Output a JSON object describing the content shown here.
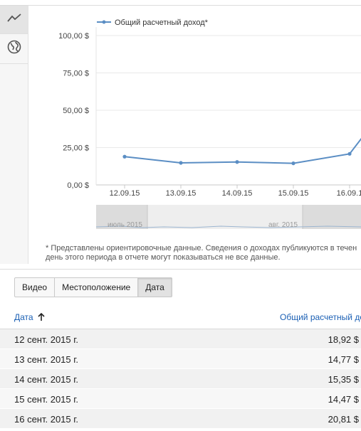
{
  "sidebar": {
    "tools": [
      {
        "icon": "line-chart-icon",
        "active": true
      },
      {
        "icon": "globe-icon",
        "active": false
      }
    ]
  },
  "chart_data": {
    "type": "line",
    "legend": "Общий расчетный доход*",
    "legend_position": "top-left",
    "x": [
      "12.09.15",
      "13.09.15",
      "14.09.15",
      "15.09.15",
      "16.09.1"
    ],
    "series": [
      {
        "name": "Общий расчетный доход*",
        "values": [
          18.92,
          14.77,
          15.35,
          14.47,
          20.81
        ],
        "color": "#5b8ec4"
      }
    ],
    "y_ticks": [
      "100,00 $",
      "75,00 $",
      "50,00 $",
      "25,00 $",
      "0,00 $"
    ],
    "ylim": [
      0,
      100
    ],
    "grid": true,
    "navigator": {
      "labels": [
        "июль 2015",
        "авг. 2015"
      ]
    }
  },
  "footnote": {
    "line1": "* Представлены ориентировочные данные. Сведения о доходах публикуются в течен",
    "line2": "день этого периода в отчете могут показываться не все данные."
  },
  "tabs": [
    {
      "label": "Видео",
      "selected": false
    },
    {
      "label": "Местоположение",
      "selected": false
    },
    {
      "label": "Дата",
      "selected": true
    }
  ],
  "table": {
    "col_date": "Дата",
    "col_revenue": "Общий расчетный дох",
    "rows": [
      {
        "date": "12 сент. 2015 г.",
        "value": "18,92 $"
      },
      {
        "date": "13 сент. 2015 г.",
        "value": "14,77 $"
      },
      {
        "date": "14 сент. 2015 г.",
        "value": "15,35 $"
      },
      {
        "date": "15 сент. 2015 г.",
        "value": "14,47 $"
      },
      {
        "date": "16 сент. 2015 г.",
        "value": "20,81 $"
      }
    ]
  }
}
